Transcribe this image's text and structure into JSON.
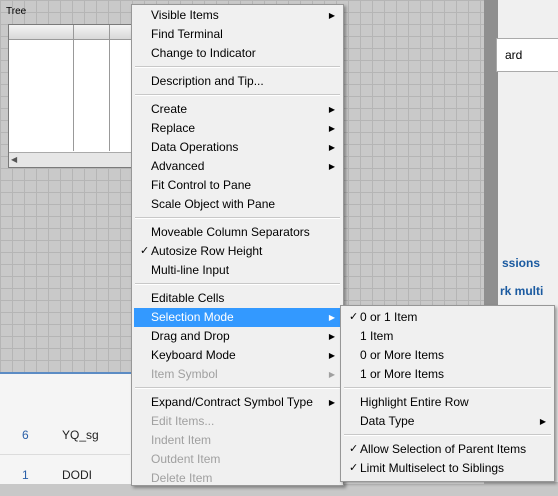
{
  "canvas": {
    "tree_label": "Tree"
  },
  "right_panel": {
    "field_text": "ard",
    "link1": "ssions",
    "link2": "rk multi"
  },
  "bottom_list": [
    {
      "num": "6",
      "name": "YQ_sg"
    },
    {
      "num": "1",
      "name": "DODI"
    }
  ],
  "context_menu": {
    "groups": [
      [
        {
          "label": "Visible Items",
          "submenu": true
        },
        {
          "label": "Find Terminal"
        },
        {
          "label": "Change to Indicator"
        }
      ],
      [
        {
          "label": "Description and Tip..."
        }
      ],
      [
        {
          "label": "Create",
          "submenu": true
        },
        {
          "label": "Replace",
          "submenu": true
        },
        {
          "label": "Data Operations",
          "submenu": true
        },
        {
          "label": "Advanced",
          "submenu": true
        },
        {
          "label": "Fit Control to Pane"
        },
        {
          "label": "Scale Object with Pane"
        }
      ],
      [
        {
          "label": "Moveable Column Separators"
        },
        {
          "label": "Autosize Row Height",
          "checked": true
        },
        {
          "label": "Multi-line Input"
        }
      ],
      [
        {
          "label": "Editable Cells"
        },
        {
          "label": "Selection Mode",
          "submenu": true,
          "highlighted": true
        },
        {
          "label": "Drag and Drop",
          "submenu": true
        },
        {
          "label": "Keyboard Mode",
          "submenu": true
        },
        {
          "label": "Item Symbol",
          "submenu": true,
          "disabled": true
        }
      ],
      [
        {
          "label": "Expand/Contract Symbol Type",
          "submenu": true
        },
        {
          "label": "Edit Items...",
          "disabled": true
        },
        {
          "label": "Indent Item",
          "disabled": true
        },
        {
          "label": "Outdent Item",
          "disabled": true
        },
        {
          "label": "Delete Item",
          "disabled": true
        }
      ]
    ]
  },
  "submenu": {
    "groups": [
      [
        {
          "label": "0 or 1 Item",
          "checked": true
        },
        {
          "label": "1 Item"
        },
        {
          "label": "0 or More Items"
        },
        {
          "label": "1 or More Items"
        }
      ],
      [
        {
          "label": "Highlight Entire Row"
        },
        {
          "label": "Data Type",
          "submenu": true
        }
      ],
      [
        {
          "label": "Allow Selection of Parent Items",
          "checked": true
        },
        {
          "label": "Limit Multiselect to Siblings",
          "checked": true
        }
      ]
    ]
  },
  "glyphs": {
    "check": "✓",
    "submenu_arrow": "▶",
    "scroll_left": "◀"
  },
  "colors": {
    "highlight": "#3399ff",
    "menu_bg": "#f0f0f0",
    "disabled_text": "#a0a0a0"
  }
}
